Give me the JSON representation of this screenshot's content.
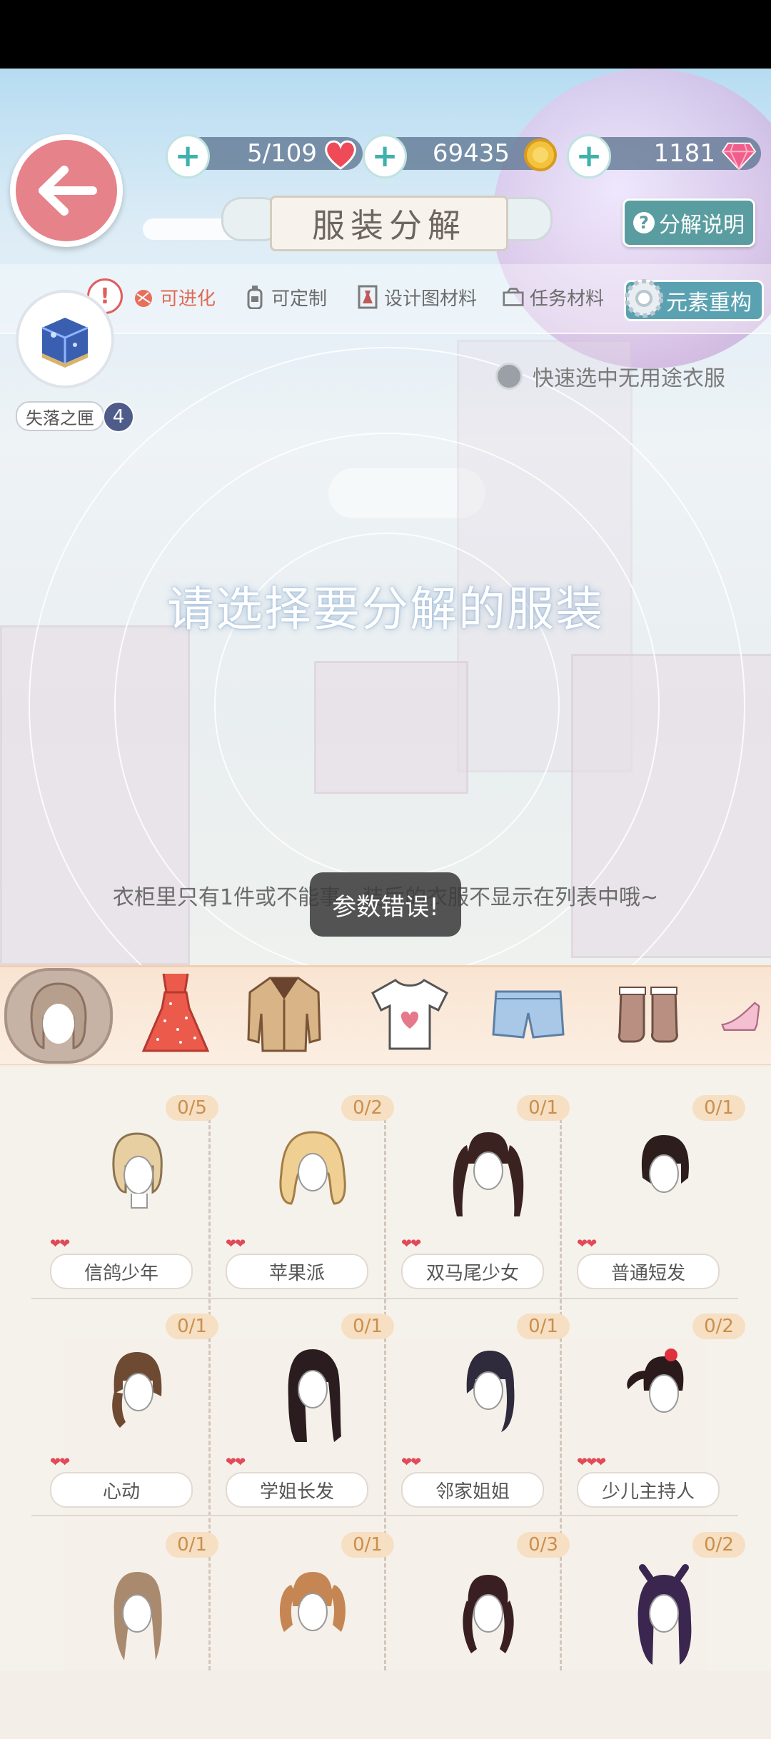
{
  "currencies": {
    "stamina": "5/109",
    "gold": "69435",
    "diamonds": "1181"
  },
  "title": "服装分解",
  "help_label": "分解说明",
  "filters": [
    {
      "label": "可进化"
    },
    {
      "label": "可定制"
    },
    {
      "label": "设计图材料"
    },
    {
      "label": "任务材料"
    }
  ],
  "alert_mark": "!",
  "element_rebuild_label": "元素重构",
  "lost_box": {
    "label": "失落之匣",
    "count": "4"
  },
  "quick_select_label": "快速选中无用途衣服",
  "prompt": "请选择要分解的服装",
  "hint": "衣柜里只有1件或不能事…装后的衣服不显示在列表中哦~",
  "toast": "参数错误!",
  "categories": [
    "hair",
    "dress",
    "coat",
    "top",
    "bottom",
    "socks",
    "shoes"
  ],
  "items": [
    {
      "name": "信鸽少年",
      "count": "0/5",
      "hearts": "❤❤"
    },
    {
      "name": "苹果派",
      "count": "0/2",
      "hearts": "❤❤"
    },
    {
      "name": "双马尾少女",
      "count": "0/1",
      "hearts": "❤❤"
    },
    {
      "name": "普通短发",
      "count": "0/1",
      "hearts": "❤❤"
    },
    {
      "name": "心动",
      "count": "0/1",
      "hearts": "❤❤"
    },
    {
      "name": "学姐长发",
      "count": "0/1",
      "hearts": "❤❤"
    },
    {
      "name": "邻家姐姐",
      "count": "0/1",
      "hearts": "❤❤"
    },
    {
      "name": "少儿主持人",
      "count": "0/2",
      "hearts": "❤❤❤"
    },
    {
      "name": "",
      "count": "0/1",
      "hearts": ""
    },
    {
      "name": "",
      "count": "0/1",
      "hearts": ""
    },
    {
      "name": "",
      "count": "0/3",
      "hearts": ""
    },
    {
      "name": "",
      "count": "0/2",
      "hearts": ""
    }
  ]
}
